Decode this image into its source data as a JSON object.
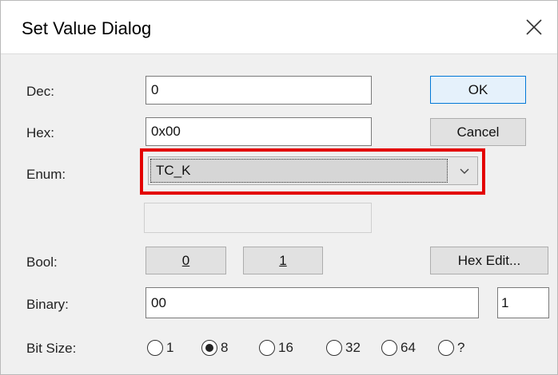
{
  "dialog": {
    "title": "Set Value Dialog",
    "close_icon": "close-icon"
  },
  "fields": {
    "dec_label": "Dec:",
    "dec_value": "0",
    "hex_label": "Hex:",
    "hex_value": "0x00",
    "enum_label": "Enum:",
    "enum_value": "TC_K",
    "bool_label": "Bool:",
    "binary_label": "Binary:",
    "binary_value": "00",
    "binary_count": "1",
    "bitsize_label": "Bit Size:"
  },
  "buttons": {
    "ok": "OK",
    "cancel": "Cancel",
    "bool_0": "0",
    "bool_1": "1",
    "hex_edit": "Hex Edit..."
  },
  "bit_size_options": [
    {
      "label": "1",
      "selected": false
    },
    {
      "label": "8",
      "selected": true
    },
    {
      "label": "16",
      "selected": false
    },
    {
      "label": "32",
      "selected": false
    },
    {
      "label": "64",
      "selected": false
    },
    {
      "label": "?",
      "selected": false
    }
  ],
  "colors": {
    "highlight": "#e30000",
    "default_button_border": "#0078d7"
  }
}
